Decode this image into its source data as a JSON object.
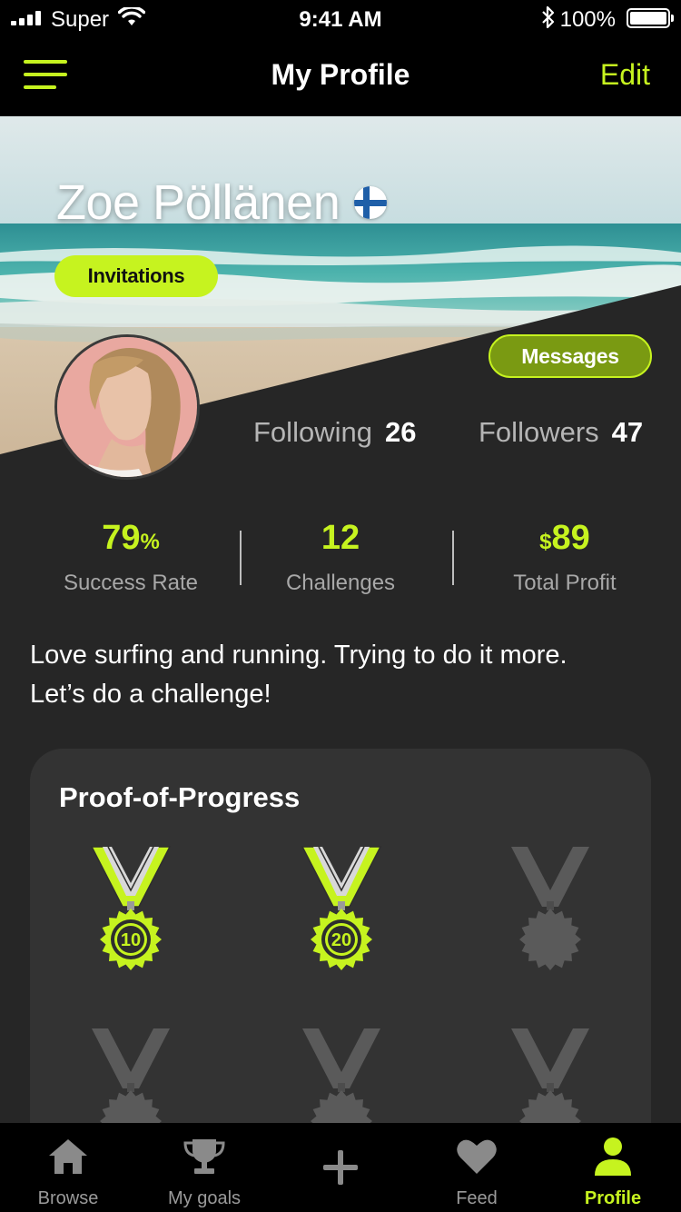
{
  "status_bar": {
    "carrier": "Super",
    "time": "9:41 AM",
    "battery": "100%"
  },
  "nav": {
    "title": "My Profile",
    "edit_label": "Edit"
  },
  "profile": {
    "name": "Zoe Pöllänen",
    "country_flag": "finland-flag-icon",
    "invitations_label": "Invitations",
    "messages_label": "Messages",
    "following_label": "Following",
    "following_count": "26",
    "followers_label": "Followers",
    "followers_count": "47"
  },
  "stats": [
    {
      "value": "79",
      "unit": "%",
      "label": "Success Rate"
    },
    {
      "value": "12",
      "label": "Challenges"
    },
    {
      "prefix": "$",
      "value": "89",
      "label": "Total Profit"
    }
  ],
  "bio": {
    "line1": "Love surfing and running. Trying to do it more.",
    "line2": "Let’s do a challenge!"
  },
  "progress": {
    "title": "Proof-of-Progress",
    "medals": [
      {
        "label": "10",
        "earned": true
      },
      {
        "label": "20",
        "earned": true
      },
      {
        "label": "",
        "earned": false
      },
      {
        "label": "",
        "earned": false
      },
      {
        "label": "",
        "earned": false
      },
      {
        "label": "",
        "earned": false
      }
    ]
  },
  "tabs": [
    {
      "label": "Browse",
      "icon": "home-icon",
      "active": false
    },
    {
      "label": "My goals",
      "icon": "trophy-icon",
      "active": false
    },
    {
      "label": "",
      "icon": "plus-icon",
      "active": false
    },
    {
      "label": "Feed",
      "icon": "heart-icon",
      "active": false
    },
    {
      "label": "Profile",
      "icon": "person-icon",
      "active": true
    }
  ],
  "colors": {
    "accent": "#c6f31f",
    "background": "#262626",
    "card": "#333333",
    "inactive_medal": "#5a5a5a"
  }
}
